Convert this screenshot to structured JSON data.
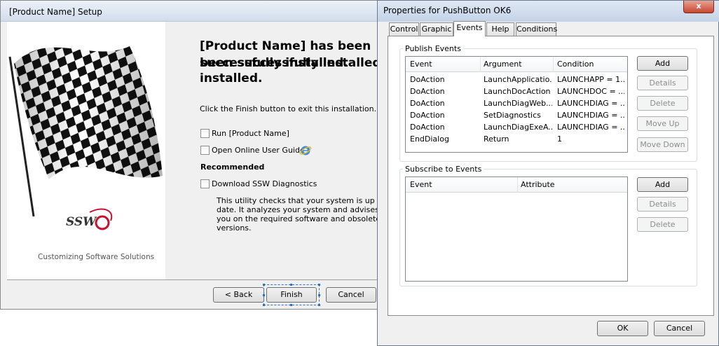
{
  "setup": {
    "title": "[Product Name] Setup",
    "heading_line1": "[Product Name] has been",
    "heading_line2a": "successfully installed.",
    "heading_line2b": "been successfully installed.",
    "heading_line3": "installed.",
    "instruction": "Click the Finish button to exit this installation.",
    "checkbox_run": "Run [Product Name]",
    "checkbox_guide": "Open Online User Guide",
    "recommended": "Recommended",
    "checkbox_diag": "Download SSW Diagnostics",
    "diag_desc": [
      "This utility checks that your system is up to",
      "date. It analyzes your system and advises",
      "you on the required software and obsolete",
      "versions."
    ],
    "logo_text": "SSW",
    "tagline": "Customizing Software Solutions",
    "buttons": {
      "back": "< Back",
      "finish": "Finish",
      "cancel": "Cancel"
    }
  },
  "props": {
    "title": "Properties for PushButton OK6",
    "close_glyph": "x",
    "tabs": [
      "Control",
      "Graphic",
      "Events",
      "Help",
      "Conditions"
    ],
    "active_tab": "Events",
    "publish": {
      "label": "Publish Events",
      "columns": [
        "Event",
        "Argument",
        "Condition"
      ],
      "rows": [
        [
          "DoAction",
          "LaunchApplicatio...",
          "LAUNCHAPP = 1..."
        ],
        [
          "DoAction",
          "LaunchDocAction",
          "LAUNCHDOC = ..."
        ],
        [
          "DoAction",
          "LaunchDiagWeb...",
          "LAUNCHDIAG = ..."
        ],
        [
          "DoAction",
          "SetDiagnostics",
          "LAUNCHDIAG = ..."
        ],
        [
          "DoAction",
          "LaunchDiagExeA...",
          "LAUNCHDIAG = ..."
        ],
        [
          "EndDialog",
          "Return",
          "1"
        ]
      ],
      "buttons": {
        "add": "Add",
        "details": "Details",
        "delete": "Delete",
        "move_up": "Move Up",
        "move_down": "Move Down"
      }
    },
    "subscribe": {
      "label": "Subscribe to Events",
      "columns": [
        "Event",
        "Attribute"
      ],
      "buttons": {
        "add": "Add",
        "details": "Details",
        "delete": "Delete"
      }
    },
    "ok": "OK",
    "cancel": "Cancel"
  },
  "colors": {
    "accent_focus": "#2a73d5",
    "logo_red": "#c8102e"
  }
}
